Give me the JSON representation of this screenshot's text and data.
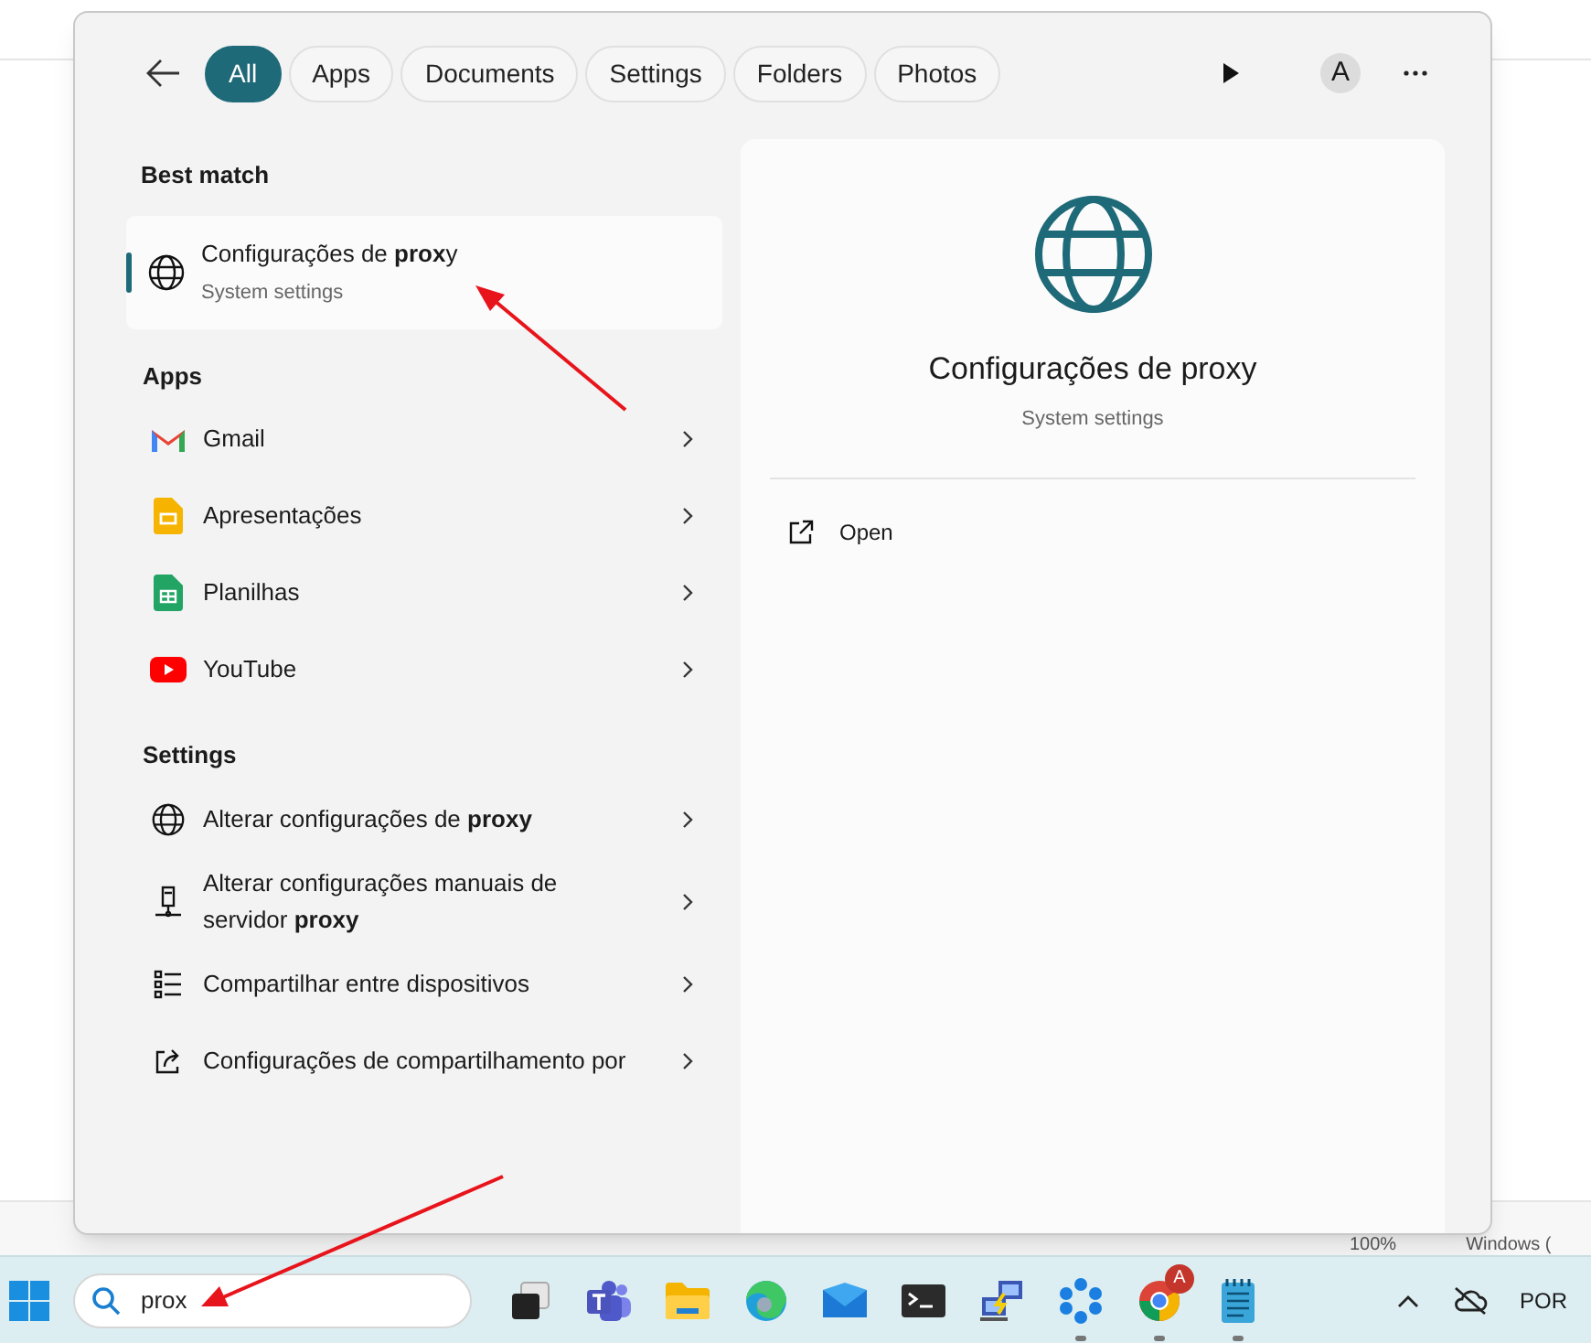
{
  "background_window": {
    "status_bar": [
      "100%",
      "Windows ("
    ]
  },
  "search_panel": {
    "filters": [
      {
        "label": "All",
        "selected": true
      },
      {
        "label": "Apps",
        "selected": false
      },
      {
        "label": "Documents",
        "selected": false
      },
      {
        "label": "Settings",
        "selected": false
      },
      {
        "label": "Folders",
        "selected": false
      },
      {
        "label": "Photos",
        "selected": false
      }
    ],
    "avatar": "A",
    "best_match": {
      "heading": "Best match",
      "title": "Configurações de **prox**y",
      "subtitle": "System settings",
      "selected": true
    },
    "groups": [
      {
        "heading": "Apps",
        "items": [
          {
            "kind": "gmail",
            "label": "Gmail"
          },
          {
            "kind": "slides",
            "label": "Apresentações"
          },
          {
            "kind": "sheets",
            "label": "Planilhas"
          },
          {
            "kind": "youtube",
            "label": "YouTube"
          }
        ]
      },
      {
        "heading": "Settings",
        "items": [
          {
            "kind": "globe",
            "label": "Alterar configurações de **proxy**"
          },
          {
            "kind": "server",
            "label": "Alterar configurações manuais de servidor **proxy**"
          },
          {
            "kind": "list",
            "label": "Compartilhar entre dispositivos"
          },
          {
            "kind": "share",
            "label": "Configurações de compartilhamento por"
          }
        ]
      }
    ],
    "preview": {
      "title": "Configurações de proxy",
      "subtitle": "System settings",
      "actions": [
        {
          "label": "Open"
        }
      ]
    }
  },
  "taskbar": {
    "search": {
      "value": "prox"
    },
    "apps": [
      {
        "kind": "taskview",
        "running": false
      },
      {
        "kind": "teams",
        "running": false
      },
      {
        "kind": "folder",
        "running": false
      },
      {
        "kind": "edge",
        "running": false
      },
      {
        "kind": "mail",
        "running": false
      },
      {
        "kind": "terminal",
        "running": false
      },
      {
        "kind": "network",
        "running": false
      },
      {
        "kind": "copilot",
        "running": true
      },
      {
        "kind": "chrome",
        "running": true,
        "badge": "A"
      },
      {
        "kind": "notepad",
        "running": true
      }
    ],
    "language": "POR"
  }
}
